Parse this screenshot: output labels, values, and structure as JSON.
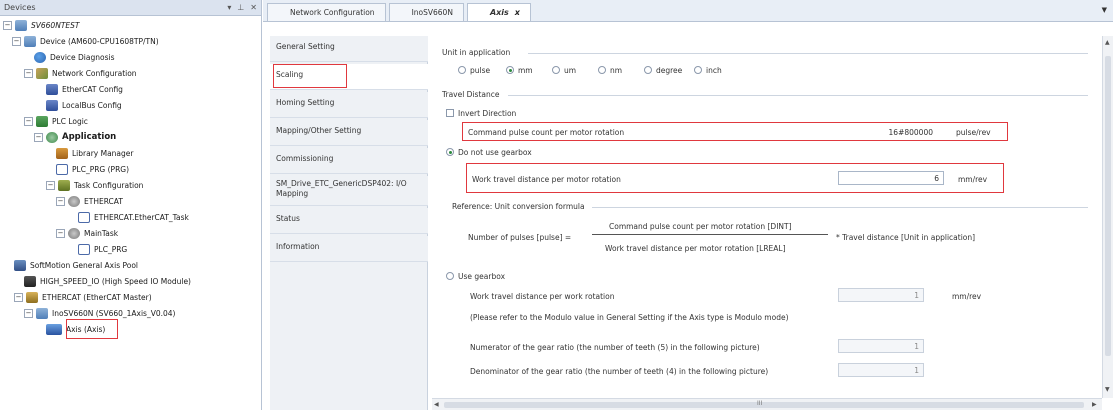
{
  "devices_panel": {
    "title": "Devices",
    "pin": "▾",
    "dock": "⊥",
    "close": "✕",
    "tree": [
      {
        "label": "SV660NTEST",
        "expander": "−"
      },
      {
        "label": "Device (AM600-CPU1608TP/TN)",
        "expander": "−"
      },
      {
        "label": "Device Diagnosis",
        "expander": ""
      },
      {
        "label": "Network Configuration",
        "expander": "−"
      },
      {
        "label": "EtherCAT Config",
        "expander": ""
      },
      {
        "label": "LocalBus Config",
        "expander": ""
      },
      {
        "label": "PLC Logic",
        "expander": "−"
      },
      {
        "label": "Application",
        "expander": "−"
      },
      {
        "label": "Library Manager",
        "expander": ""
      },
      {
        "label": "PLC_PRG (PRG)",
        "expander": ""
      },
      {
        "label": "Task Configuration",
        "expander": "−"
      },
      {
        "label": "ETHERCAT",
        "expander": "−"
      },
      {
        "label": "ETHERCAT.EtherCAT_Task",
        "expander": ""
      },
      {
        "label": "MainTask",
        "expander": "−"
      },
      {
        "label": "PLC_PRG",
        "expander": ""
      },
      {
        "label": "SoftMotion General Axis Pool",
        "expander": ""
      },
      {
        "label": "HIGH_SPEED_IO (High Speed IO Module)",
        "expander": ""
      },
      {
        "label": "ETHERCAT (EtherCAT Master)",
        "expander": "−"
      },
      {
        "label": "InoSV660N (SV660_1Axis_V0.04)",
        "expander": "−"
      },
      {
        "label": "Axis (Axis)",
        "expander": ""
      }
    ]
  },
  "tabs": {
    "items": [
      {
        "label": "Network Configuration"
      },
      {
        "label": "InoSV660N"
      },
      {
        "label": "Axis",
        "close": "x"
      }
    ],
    "more": "▼"
  },
  "leftnav": [
    {
      "label": "General Setting"
    },
    {
      "label": "Scaling"
    },
    {
      "label": "Homing Setting"
    },
    {
      "label": "Mapping/Other Setting"
    },
    {
      "label": "Commissioning"
    },
    {
      "label": "SM_Drive_ETC_GenericDSP402: I/O Mapping"
    },
    {
      "label": "Status"
    },
    {
      "label": "Information"
    }
  ],
  "scaling": {
    "unit_title": "Unit in application",
    "units": [
      {
        "label": "pulse",
        "selected": false
      },
      {
        "label": "mm",
        "selected": true
      },
      {
        "label": "um",
        "selected": false
      },
      {
        "label": "nm",
        "selected": false
      },
      {
        "label": "degree",
        "selected": false
      },
      {
        "label": "inch",
        "selected": false
      }
    ],
    "travel_title": "Travel Distance",
    "invert_direction": "Invert Direction",
    "cmd_pulse_label": "Command pulse count per motor rotation",
    "cmd_pulse_value": "16#800000",
    "cmd_pulse_unit": "pulse/rev",
    "no_gearbox": "Do not use gearbox",
    "work_travel_label": "Work travel distance per motor rotation",
    "work_travel_value": "6",
    "work_travel_unit": "mm/rev",
    "formula_title": "Reference: Unit conversion formula",
    "formula_left": "Number of pulses [pulse] =",
    "formula_num": "Command pulse count per motor rotation [DINT]",
    "formula_den": "Work travel distance per motor rotation [LREAL]",
    "formula_right": "* Travel distance [Unit in application]",
    "use_gearbox": "Use gearbox",
    "gear_work_label": "Work travel distance per work rotation",
    "gear_work_value": "1",
    "gear_work_unit": "mm/rev",
    "modulo_note": "(Please refer to the Modulo value in General Setting if the Axis type is Modulo mode)",
    "numerator_label": "Numerator of the gear ratio (the number of teeth (5) in the following picture)",
    "numerator_value": "1",
    "denominator_label": "Denominator of the gear ratio (the number of teeth (4) in the following picture)",
    "denominator_value": "1"
  },
  "scroll": {
    "up": "▲",
    "down": "▼",
    "left": "◀",
    "right": "▶",
    "grip": "III"
  }
}
